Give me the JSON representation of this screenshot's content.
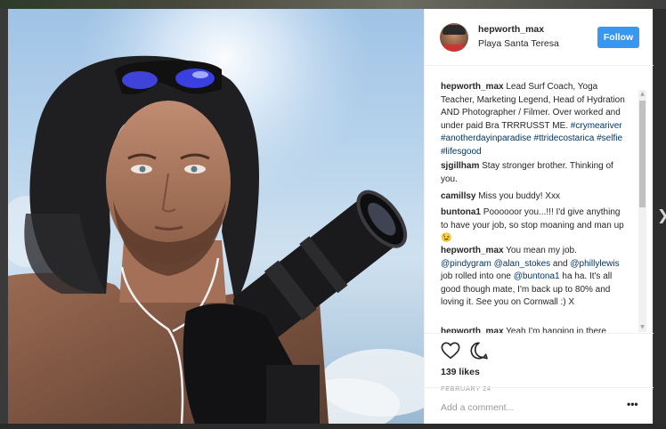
{
  "post": {
    "username": "hepworth_max",
    "location": "Playa Santa Teresa",
    "follow_label": "Follow",
    "likes": "139 likes",
    "date": "FEBRUARY 24",
    "add_comment_placeholder": "Add a comment...",
    "more_options": "•••"
  },
  "comments": [
    {
      "user": "hepworth_max",
      "parts": [
        {
          "t": " Lead Surf Coach, Yoga Teacher, Marketing Legend, Head of Hydration AND Photographer / Filmer. Over worked and under paid Bra TRRRUSST ME. "
        },
        {
          "tag": "#crymeariver"
        },
        {
          "t": " "
        },
        {
          "tag": "#anotherdayinparadise"
        },
        {
          "t": " "
        },
        {
          "tag": "#ttridecostarica"
        },
        {
          "t": " "
        },
        {
          "tag": "#selfie"
        },
        {
          "t": " "
        },
        {
          "tag": "#lifesgood"
        }
      ]
    },
    {
      "user": "sjgillham",
      "parts": [
        {
          "t": " Stay stronger brother. Thinking of you."
        }
      ]
    },
    {
      "user": "camillsy",
      "parts": [
        {
          "t": " Miss you buddy! Xxx"
        }
      ]
    },
    {
      "user": "buntona1",
      "parts": [
        {
          "t": " Poooooor you...!!! I'd give anything to have your job, so stop moaning and man up 😉"
        }
      ]
    },
    {
      "user": "hepworth_max",
      "parts": [
        {
          "t": " You mean my job. "
        },
        {
          "tag": "@pindygram"
        },
        {
          "t": " "
        },
        {
          "tag": "@alan_stokes"
        },
        {
          "t": " and "
        },
        {
          "tag": "@phillylewis"
        },
        {
          "t": " job rolled into one "
        },
        {
          "tag": "@buntona1"
        },
        {
          "t": " ha ha. It's all good though mate, I'm back up to 80% and loving it. See you on Cornwall :) X"
        }
      ]
    },
    {
      "user": "hepworth_max",
      "parts": [
        {
          "t": " Yeah I'm hanging in there"
        }
      ]
    }
  ],
  "colors": {
    "follow_bg": "#3897f0",
    "tag": "#003569",
    "text": "#262626",
    "muted": "#999999"
  },
  "icons": {
    "like": "heart-icon",
    "comment": "speech-bubble-icon",
    "next": "chevron-right-icon"
  }
}
